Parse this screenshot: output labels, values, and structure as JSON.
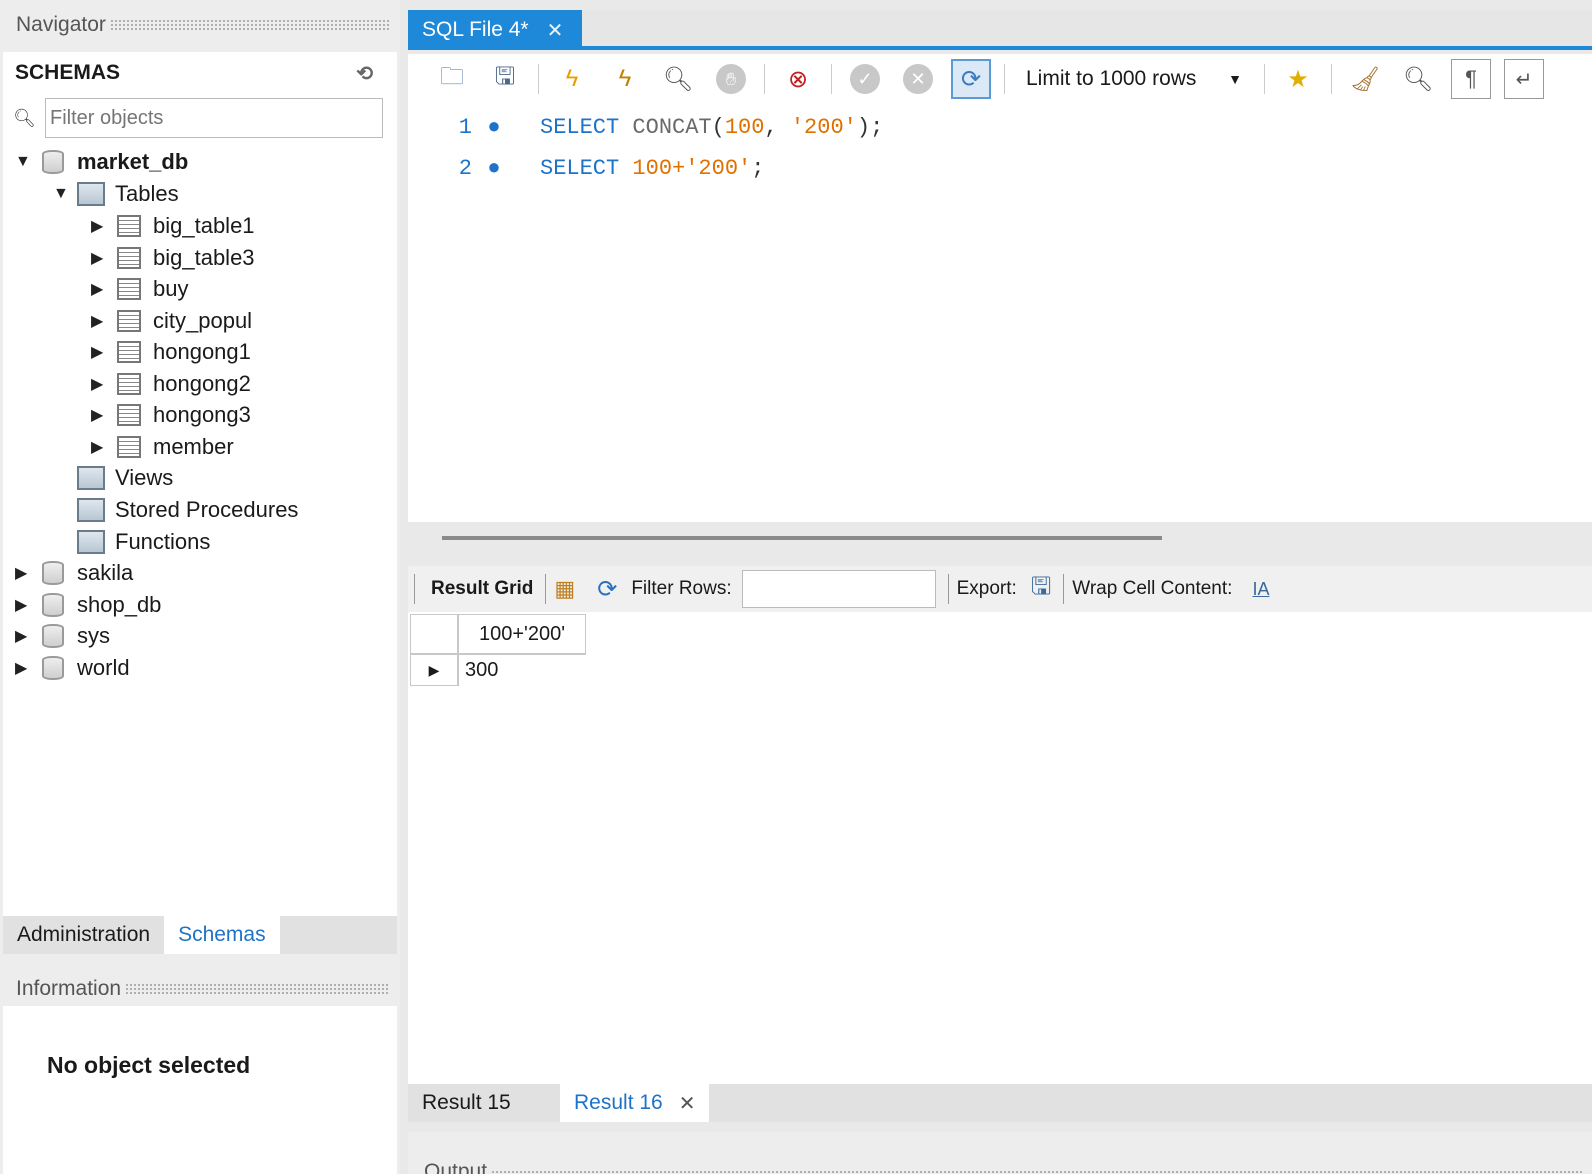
{
  "navigator": {
    "title": "Navigator",
    "schemas_label": "SCHEMAS",
    "filter_placeholder": "Filter objects",
    "tree": {
      "market_db": "market_db",
      "tables": "Tables",
      "table_items": [
        "big_table1",
        "big_table3",
        "buy",
        "city_popul",
        "hongong1",
        "hongong2",
        "hongong3",
        "member"
      ],
      "views": "Views",
      "stored_procedures": "Stored Procedures",
      "functions": "Functions",
      "other_dbs": [
        "sakila",
        "shop_db",
        "sys",
        "world"
      ]
    },
    "bottom_tabs": [
      "Administration",
      "Schemas"
    ],
    "information_title": "Information",
    "no_object": "No object selected"
  },
  "editor": {
    "tab_label": "SQL File 4*",
    "limit_label": "Limit to 1000 rows",
    "lines": [
      {
        "num": "1",
        "parts": [
          [
            "kw",
            "SELECT"
          ],
          [
            "punc",
            " "
          ],
          [
            "fn",
            "CONCAT"
          ],
          [
            "punc",
            "("
          ],
          [
            "num",
            "100"
          ],
          [
            "punc",
            ", "
          ],
          [
            "str",
            "'200'"
          ],
          [
            "punc",
            ");"
          ]
        ]
      },
      {
        "num": "2",
        "parts": [
          [
            "kw",
            "SELECT"
          ],
          [
            "punc",
            " "
          ],
          [
            "num",
            "100+"
          ],
          [
            "str",
            "'200'"
          ],
          [
            "punc",
            ";"
          ]
        ]
      }
    ]
  },
  "result": {
    "grid_label": "Result Grid",
    "filter_label": "Filter Rows:",
    "export_label": "Export:",
    "wrap_label": "Wrap Cell Content:",
    "column_header": "100+'200'",
    "row_value": "300",
    "tabs": [
      "Result 15",
      "Result 16"
    ]
  },
  "output_title": "Output"
}
